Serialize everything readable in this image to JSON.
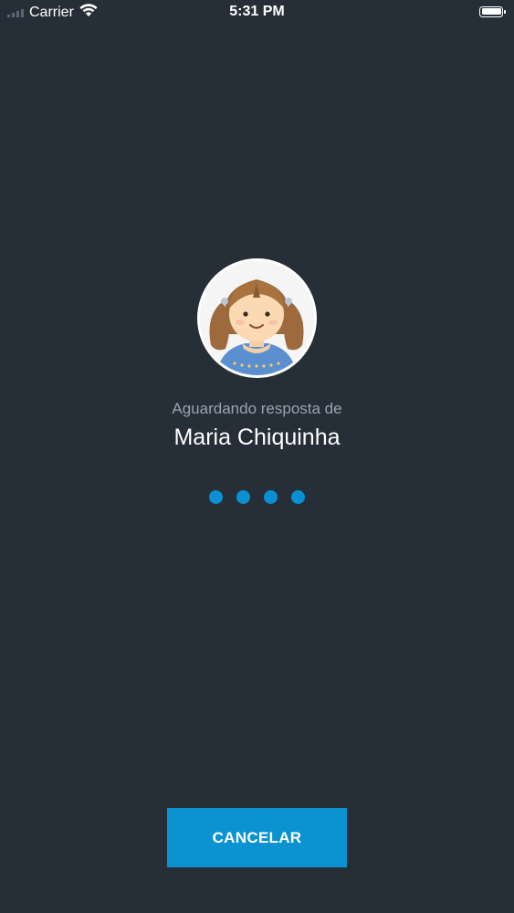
{
  "status_bar": {
    "carrier": "Carrier",
    "time": "5:31 PM",
    "wifi_icon": "wifi-icon",
    "battery_icon": "battery-icon",
    "battery_level": 1.0
  },
  "avatar": {
    "icon": "girl-avatar-icon"
  },
  "call": {
    "waiting_label": "Aguardando resposta de",
    "contact_name": "Maria Chiquinha"
  },
  "loading_dots": {
    "count": 4,
    "color": "#0a90d2"
  },
  "actions": {
    "cancel_label": "CANCELAR"
  },
  "colors": {
    "background": "#262f38",
    "accent": "#0a93d0"
  }
}
